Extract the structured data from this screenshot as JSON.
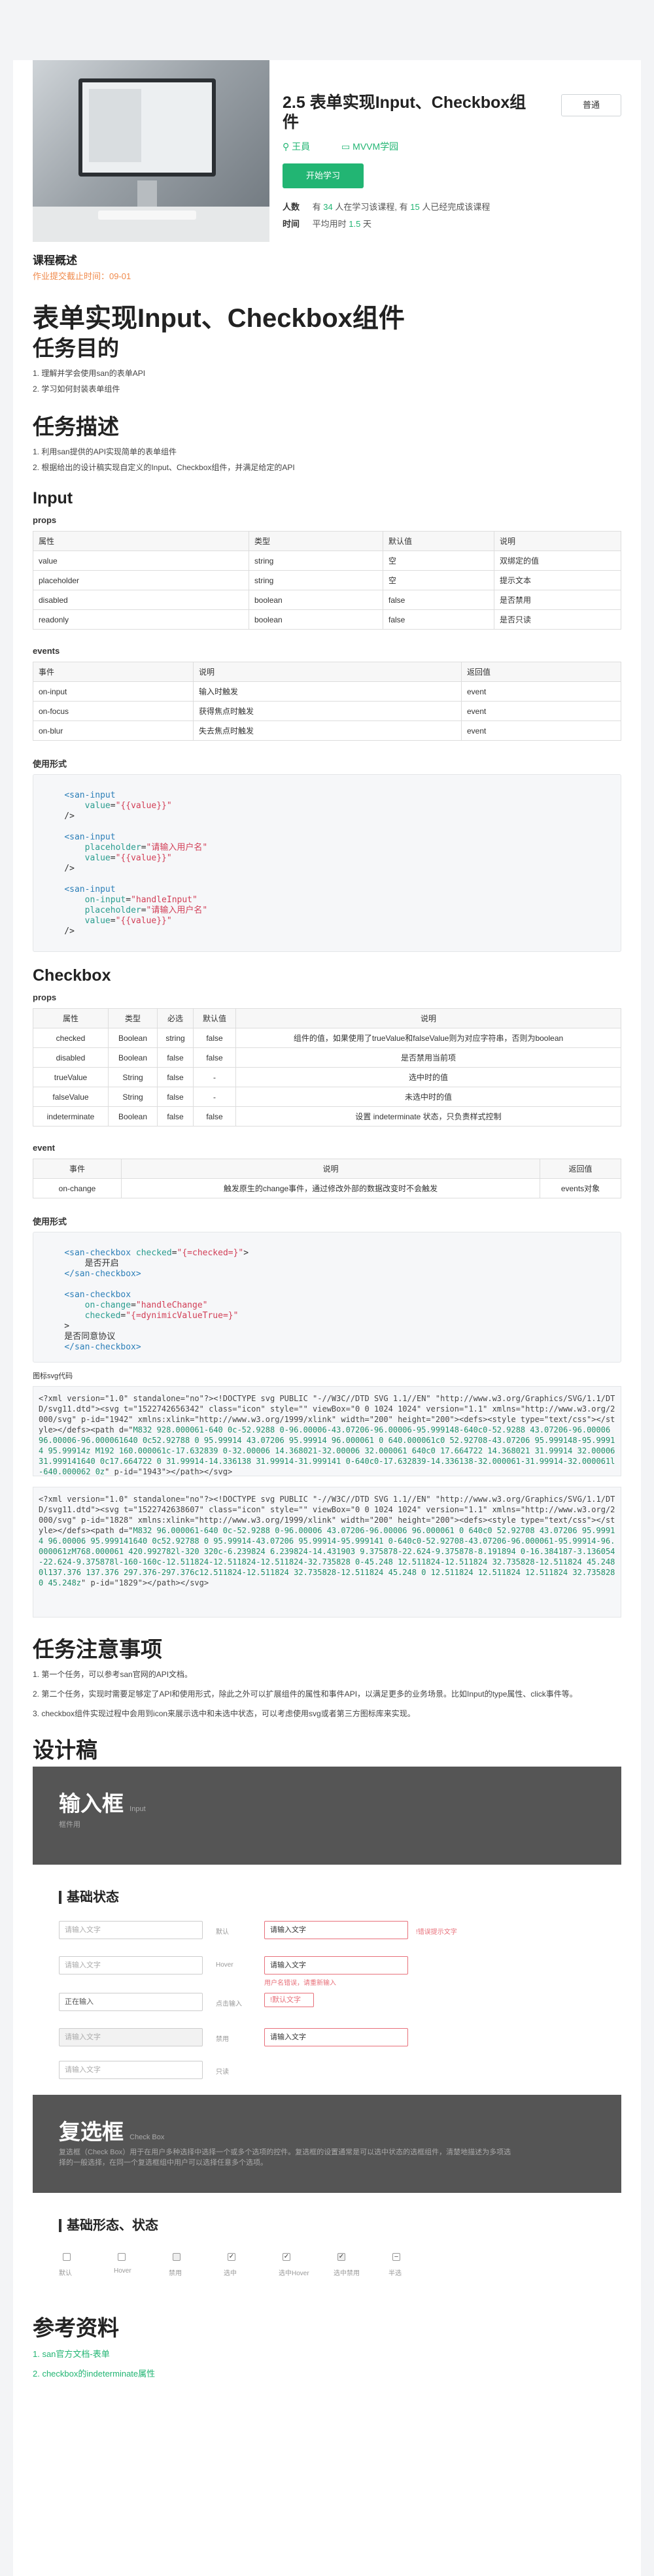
{
  "course": {
    "title": "2.5 表单实现Input、Checkbox组件",
    "follow": "普通",
    "teacher": "王員",
    "category": "MVVM学园",
    "start": "开始学习",
    "learners_label": "人数",
    "learners_text": [
      "有",
      "34",
      "人在学习该课程,",
      "有",
      "15",
      "人已经完成该课程"
    ],
    "time_label": "时间",
    "time_text": [
      "平均用时",
      "1.5",
      "天"
    ]
  },
  "overview": {
    "heading": "课程概述",
    "deadline": "作业提交截止时间：09-01"
  },
  "doc": {
    "title": "表单实现Input、Checkbox组件",
    "goal_h": "任务目的",
    "goals": [
      "1. 理解并学会使用san的表单API",
      "2. 学习如何封装表单组件"
    ],
    "desc_h": "任务描述",
    "descs": [
      "1. 利用san提供的API实现简单的表单组件",
      "2. 根据给出的设计稿实现自定义的Input、Checkbox组件，并满足给定的API"
    ],
    "input_h": "Input",
    "props_label": "props",
    "events_label": "events",
    "usage_label": "使用形式",
    "checkbox_h": "Checkbox",
    "event_label": "event",
    "svg_label": "图标svg代码",
    "notes_h": "任务注意事项",
    "notes": [
      "1. 第一个任务，可以参考san官网的API文档。",
      "2. 第二个任务，实现时需要足够定了API和使用形式，除此之外可以扩展组件的属性和事件API，以满足更多的业务场景。比如Input的type属性、click事件等。",
      "3. checkbox组件实现过程中会用到icon来展示选中和未选中状态，可以考虑使用svg或者第三方图标库来实现。"
    ],
    "design_h": "设计稿",
    "ref_h": "参考资料",
    "refs": [
      "1. san官方文档-表单",
      "2. checkbox的indeterminate属性"
    ]
  },
  "input_props": {
    "headers": [
      "属性",
      "类型",
      "默认值",
      "说明"
    ],
    "rows": [
      [
        "value",
        "string",
        "空",
        "双绑定的值"
      ],
      [
        "placeholder",
        "string",
        "空",
        "提示文本"
      ],
      [
        "disabled",
        "boolean",
        "false",
        "是否禁用"
      ],
      [
        "readonly",
        "boolean",
        "false",
        "是否只读"
      ]
    ]
  },
  "input_events": {
    "headers": [
      "事件",
      "说明",
      "返回值"
    ],
    "rows": [
      [
        "on-input",
        "输入时触发",
        "event"
      ],
      [
        "on-focus",
        "获得焦点时触发",
        "event"
      ],
      [
        "on-blur",
        "失去焦点时触发",
        "event"
      ]
    ]
  },
  "checkbox_props": {
    "headers": [
      "属性",
      "类型",
      "必选",
      "默认值",
      "说明"
    ],
    "rows": [
      [
        "checked",
        "Boolean",
        "string",
        "false",
        "组件的值，如果使用了trueValue和falseValue则为对应字符串，否则为boolean"
      ],
      [
        "disabled",
        "Boolean",
        "false",
        "false",
        "是否禁用当前项"
      ],
      [
        "trueValue",
        "String",
        "false",
        "-",
        "选中时的值"
      ],
      [
        "falseValue",
        "String",
        "false",
        "-",
        "未选中时的值"
      ],
      [
        "indeterminate",
        "Boolean",
        "false",
        "false",
        "设置 indeterminate 状态，只负责样式控制"
      ]
    ]
  },
  "checkbox_events": {
    "headers": [
      "事件",
      "说明",
      "返回值"
    ],
    "rows": [
      [
        "on-change",
        "触发原生的change事件，通过修改外部的数据改变时不会触发",
        "events对象"
      ]
    ]
  },
  "design": {
    "input_title": "输入框",
    "input_en": "Input",
    "input_sub": "框件用",
    "basic_state": "基础状态",
    "placeholder": "请输入文字",
    "entered": "请输入文字",
    "focus_label": "正在输入",
    "checkbox_title": "复选框",
    "checkbox_en": "Check Box",
    "checkbox_sub": "复选框（Check Box）用于在用户多种选择中选择一个或多个选项的控件。复选框的设置通常是可以选中状态的选框组件，清楚地描述为多项选择的一般选择，在同一个复选框组中用户可以选择任意多个选项。",
    "basic_shape": "基础形态、状态"
  }
}
